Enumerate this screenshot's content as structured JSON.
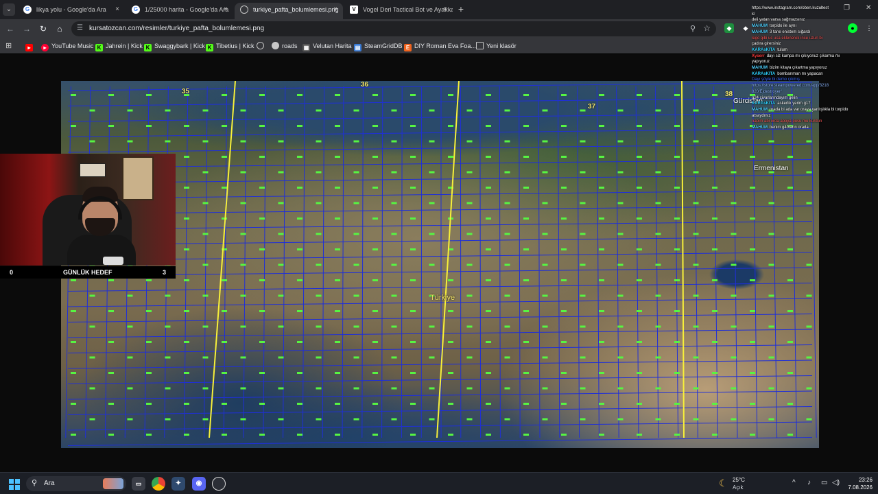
{
  "browser": {
    "tabs": [
      {
        "title": "likya yolu - Google'da Ara",
        "favicon": "G",
        "active": false
      },
      {
        "title": "1/25000 harita - Google'da Ara",
        "favicon": "G",
        "active": false
      },
      {
        "title": "turkiye_pafta_bolumlemesi.png",
        "favicon": "globe",
        "active": true
      },
      {
        "title": "Vogel Deri Tactical Bot ve Ayakka",
        "favicon": "V",
        "active": false
      }
    ],
    "close_glyph": "×",
    "new_tab_glyph": "+",
    "url": "kursatozcan.com/resimler/turkiye_pafta_bolumlemesi.png",
    "bookmarks": [
      {
        "label": "",
        "icon": "youtube-icon",
        "color": "#ff0000"
      },
      {
        "label": "YouTube Music",
        "icon": "youtube-music-icon",
        "color": "#ff0033"
      },
      {
        "label": "Jahrein | Kick",
        "icon": "kick-icon",
        "color": "#53fc18"
      },
      {
        "label": "Swaggybark | Kick",
        "icon": "kick-icon",
        "color": "#53fc18"
      },
      {
        "label": "Tibetius | Kick",
        "icon": "kick-icon",
        "color": "#53fc18"
      },
      {
        "label": "",
        "icon": "globe-icon",
        "color": "#9aa0a6"
      },
      {
        "label": "roads",
        "icon": "globe-icon",
        "color": "#9aa0a6"
      },
      {
        "label": "Velutan Harita",
        "icon": "map-icon",
        "color": "#9aa0a6"
      },
      {
        "label": "SteamGridDB",
        "icon": "steamgriddb-icon",
        "color": "#3a7bd5"
      },
      {
        "label": "DIY Roman Eva Foa...",
        "icon": "etsy-icon",
        "color": "#f1641e"
      },
      {
        "label": "Yeni klasör",
        "icon": "folder-icon",
        "color": "#9aa0a6"
      }
    ]
  },
  "map": {
    "country_label": "Türkiye",
    "zone_labels": [
      "35",
      "36",
      "37",
      "38"
    ],
    "neighbor_labels": [
      "Gürcistan",
      "Ermenistan"
    ],
    "grid_color": "#1f2fd8",
    "zone_line_color": "#f7f03a",
    "cell_label_color": "#57f542"
  },
  "overlay": {
    "goal_left": "0",
    "goal_label": "GÜNLÜK HEDEF",
    "goal_right": "3",
    "chat": [
      {
        "user": "",
        "msg": "https://www.instagram.com/oben.kuzultest",
        "color": "#ffffff"
      },
      {
        "user": "",
        "msg": "k/",
        "color": "#ffffff"
      },
      {
        "user": "",
        "msg": "deli yatan varsa sağmazsınız",
        "color": "#ffffff"
      },
      {
        "user": "MAHUM",
        "msg": "torpido ile aynı",
        "color": "#4fd1ff"
      },
      {
        "user": "MAHUM",
        "msg": "3 tane enistem sığardı",
        "color": "#4fd1ff"
      },
      {
        "user": "",
        "msg": "lego gibi uc uca eklenerek ince uzun bi",
        "color": "#ff5a5a"
      },
      {
        "user": "",
        "msg": "çadıra girersiniz",
        "color": "#ffffff"
      },
      {
        "user": "KARAsKITA",
        "msg": "tulum",
        "color": "#2fd3ff"
      },
      {
        "user": "Xyserr",
        "msg": "dayı siz kampa mı çıkıyonuz çıkarma mı",
        "color": "#ff3b3b"
      },
      {
        "user": "",
        "msg": "yapıyoruz",
        "color": "#ffffff"
      },
      {
        "user": "MAHUM",
        "msg": "bizim kitaya çıkartma yapıyoruz",
        "color": "#4fd1ff"
      },
      {
        "user": "KARAsKITA",
        "msg": "bombarıman mı yapacan",
        "color": "#2fd3ff"
      },
      {
        "user": "",
        "msg": "Dayı şöyle bi demo çıkmış",
        "color": "#3a6bff"
      },
      {
        "user": "",
        "msg": "https://store.steampowered.com/app/3218",
        "color": "#8fb8ff"
      },
      {
        "user": "",
        "msg": "820/Ejdestroyer/",
        "color": "#8fb8ff"
      },
      {
        "user": "",
        "msg": "g24 civarlarındayım gelin",
        "color": "#ffffff"
      },
      {
        "user": "KARAsKITA",
        "msg": "askerlik yerim g17",
        "color": "#2fd3ff"
      },
      {
        "user": "MAHUM",
        "msg": "orada bi ada var oraya yanlışlıkla bi torpido",
        "color": "#4fd1ff"
      },
      {
        "user": "",
        "msg": "atsaydınız",
        "color": "#ffffff"
      },
      {
        "user": "",
        "msg": "napim abi orda apoya pusu mu kurdun",
        "color": "#ff5a5a"
      },
      {
        "user": "MAHUM",
        "msg": "benim g40ların orada",
        "color": "#4fd1ff"
      }
    ]
  },
  "taskbar": {
    "search_label": "Ara",
    "weather_temp": "25°C",
    "weather_desc": "Açık",
    "time": "23:26",
    "date": "7.08.2026"
  }
}
